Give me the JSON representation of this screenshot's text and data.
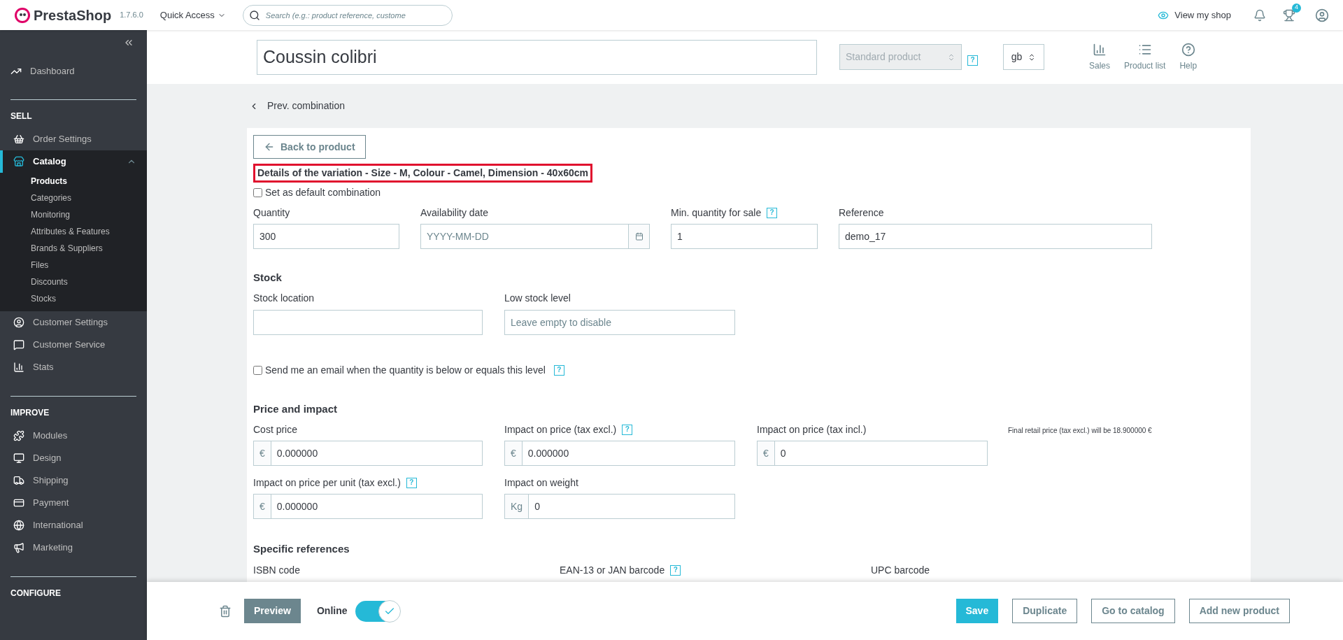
{
  "topbar": {
    "logo_text": "PrestaShop",
    "version": "1.7.6.0",
    "quick_access": "Quick Access",
    "search": {
      "placeholder": "Search (e.g.: product reference, custome"
    },
    "view_shop": "View my shop",
    "orders_badge": "4"
  },
  "sidebar": {
    "top_items": [
      {
        "label": "Dashboard",
        "selected": false
      }
    ],
    "sections": [
      {
        "title": "SELL",
        "items": [
          {
            "label": "Order Settings",
            "selected": false,
            "expanded": false
          },
          {
            "label": "Catalog",
            "selected": true,
            "expanded": true,
            "children": [
              {
                "label": "Products",
                "selected": true
              },
              {
                "label": "Categories",
                "selected": false
              },
              {
                "label": "Monitoring",
                "selected": false
              },
              {
                "label": "Attributes & Features",
                "selected": false
              },
              {
                "label": "Brands & Suppliers",
                "selected": false
              },
              {
                "label": "Files",
                "selected": false
              },
              {
                "label": "Discounts",
                "selected": false
              },
              {
                "label": "Stocks",
                "selected": false
              }
            ]
          },
          {
            "label": "Customer Settings",
            "selected": false,
            "expanded": false
          },
          {
            "label": "Customer Service",
            "selected": false,
            "expanded": false
          },
          {
            "label": "Stats",
            "selected": false,
            "expanded": false
          }
        ]
      },
      {
        "title": "IMPROVE",
        "items": [
          {
            "label": "Modules",
            "selected": false,
            "expanded": false
          },
          {
            "label": "Design",
            "selected": false,
            "expanded": false
          },
          {
            "label": "Shipping",
            "selected": false,
            "expanded": false
          },
          {
            "label": "Payment",
            "selected": false,
            "expanded": false
          },
          {
            "label": "International",
            "selected": false,
            "expanded": false
          },
          {
            "label": "Marketing",
            "selected": false,
            "expanded": false
          }
        ]
      },
      {
        "title": "CONFIGURE"
      }
    ]
  },
  "header": {
    "product_name": "Coussin colibri",
    "product_type": {
      "value": "Standard product",
      "disabled": true,
      "help": "?"
    },
    "language": "gb",
    "tools": [
      "Sales",
      "Product list",
      "Help"
    ]
  },
  "form": {
    "prev_link": "Prev. combination",
    "back_button": "Back to product",
    "title": "Details of the variation - Size - M, Colour - Camel, Dimension - 40x60cm",
    "default_checkbox": {
      "label": "Set as default combination",
      "checked": false
    },
    "main_fields": [
      {
        "kind": "text",
        "label": "Quantity",
        "value": "300"
      },
      {
        "kind": "date",
        "label": "Availability date",
        "placeholder": "YYYY-MM-DD"
      },
      {
        "kind": "text",
        "label": "Min. quantity for sale",
        "value": "1",
        "help": "?"
      },
      {
        "kind": "text",
        "label": "Reference",
        "value": "demo_17"
      }
    ],
    "stock": {
      "title": "Stock",
      "fields": [
        {
          "kind": "text",
          "label": "Stock location"
        },
        {
          "kind": "text",
          "label": "Low stock level",
          "placeholder": "Leave empty to disable"
        }
      ],
      "email_checkbox": {
        "label": "Send me an email when the quantity is below or equals this level",
        "checked": false,
        "help": "?"
      }
    },
    "price": {
      "title": "Price and impact",
      "rows": [
        [
          {
            "kind": "prefixed",
            "prefix": "€",
            "label": "Cost price",
            "value": "0.000000"
          },
          {
            "kind": "prefixed",
            "prefix": "€",
            "label": "Impact on price (tax excl.)",
            "value": "0.000000",
            "help": "?"
          },
          {
            "kind": "prefixed",
            "prefix": "€",
            "label": "Impact on price (tax incl.)",
            "value": "0"
          }
        ],
        [
          {
            "kind": "prefixed",
            "prefix": "€",
            "label": "Impact on price per unit (tax excl.)",
            "value": "0.000000",
            "help": "?"
          },
          {
            "kind": "prefixed",
            "prefix": "Kg",
            "label": "Impact on weight",
            "value": "0"
          }
        ]
      ],
      "note": "Final retail price (tax excl.) will be 18.900000 €"
    },
    "references": {
      "title": "Specific references",
      "labels": [
        {
          "label": "ISBN code"
        },
        {
          "label": "EAN-13 or JAN barcode",
          "help": "?"
        },
        {
          "label": "UPC barcode"
        }
      ]
    }
  },
  "footer": {
    "preview": "Preview",
    "online": {
      "label": "Online",
      "on": true
    },
    "buttons": [
      {
        "label": "Save",
        "kind": "primary"
      },
      {
        "label": "Duplicate",
        "kind": "outline"
      },
      {
        "label": "Go to catalog",
        "kind": "outline"
      },
      {
        "label": "Add new product",
        "kind": "outline"
      }
    ]
  }
}
